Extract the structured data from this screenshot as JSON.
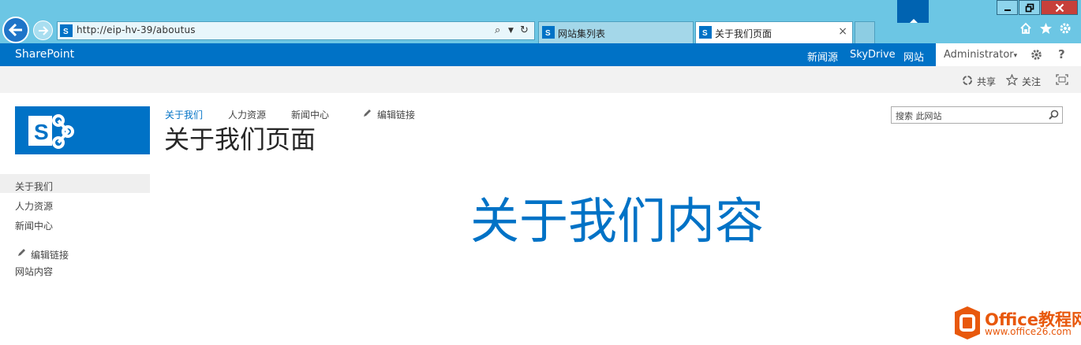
{
  "browser": {
    "address_url": "http://eip-hv-39/aboutus",
    "tabs": [
      {
        "label": "网站集列表",
        "active": false
      },
      {
        "label": "关于我们页面",
        "active": true
      }
    ],
    "icons": [
      "back-arrow-icon",
      "forward-arrow-icon",
      "search-icon",
      "dropdown-icon",
      "refresh-icon",
      "tab-close-icon",
      "home-icon",
      "favorites-star-icon",
      "tools-gear-icon",
      "minimize-icon",
      "restore-icon",
      "close-icon"
    ]
  },
  "suitebar": {
    "brand": "SharePoint",
    "links": [
      "新闻源",
      "SkyDrive",
      "网站"
    ],
    "active_link": "网站",
    "user": "Administrator",
    "user_caret": "▾",
    "settings_icon": "gear-icon",
    "help": "?"
  },
  "ribbon": {
    "share": "共享",
    "follow": "关注",
    "focus_icon": "focus-mode-icon"
  },
  "site": {
    "top_nav": [
      "关于我们",
      "人力资源",
      "新闻中心"
    ],
    "edit_links": "编辑链接",
    "page_title": "关于我们页面",
    "search_placeholder": "搜索 此网站",
    "quick_launch": [
      "关于我们",
      "人力资源",
      "新闻中心"
    ],
    "quick_launch_edit": "编辑链接",
    "site_contents": "网站内容",
    "content": "关于我们内容"
  },
  "watermark": {
    "name": "Office教程网",
    "url": "www.office26.com"
  },
  "colors": {
    "chrome": "#6cc6e4",
    "suitebar": "#0072c6",
    "accent": "#0072c6",
    "watermark": "#e8580c"
  }
}
